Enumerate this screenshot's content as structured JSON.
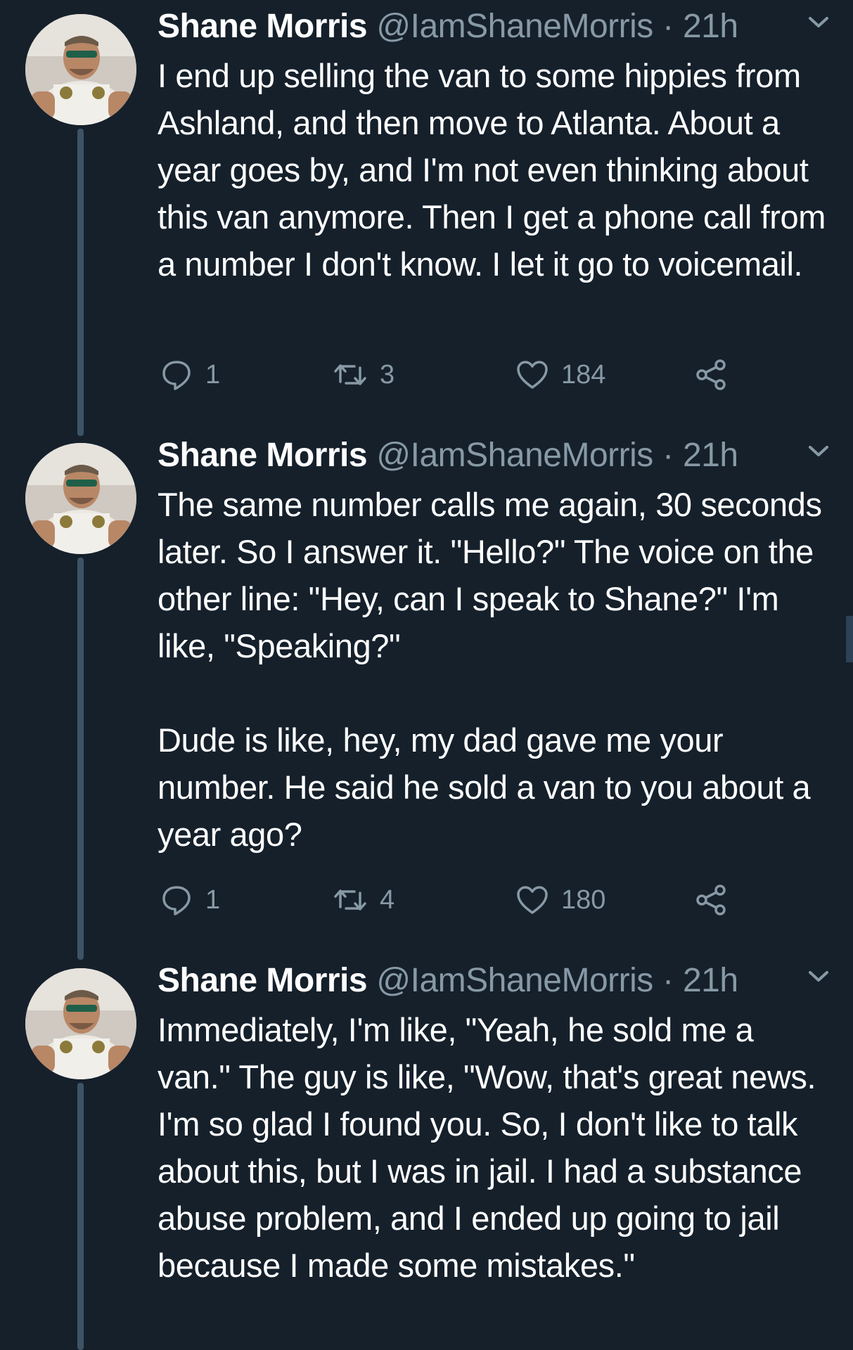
{
  "colors": {
    "background": "#15202b",
    "text_primary": "#ffffff",
    "text_secondary": "#8899a6",
    "thread_line": "#3d5466"
  },
  "tweets": [
    {
      "name": "Shane Morris",
      "handle": "@IamShaneMorris",
      "separator": "·",
      "time": "21h",
      "paragraphs": [
        "I end up selling the van to some hippies from Ashland, and then move to Atlanta. About a year goes by, and I'm not even thinking about this van anymore. Then I get a phone call from a number I don't know. I let it go to voicemail."
      ],
      "replies": "1",
      "retweets": "3",
      "likes": "184",
      "icons": [
        "reply-icon",
        "retweet-icon",
        "like-icon",
        "share-icon",
        "chevron-down-icon"
      ]
    },
    {
      "name": "Shane Morris",
      "handle": "@IamShaneMorris",
      "separator": "·",
      "time": "21h",
      "paragraphs": [
        "The same number calls me again, 30 seconds later. So I answer it. \"Hello?\" The voice on the other line: \"Hey, can I speak to Shane?\" I'm like, \"Speaking?\"",
        "Dude is like, hey, my dad gave me your number. He said he sold a van to you about a year ago?"
      ],
      "replies": "1",
      "retweets": "4",
      "likes": "180",
      "icons": [
        "reply-icon",
        "retweet-icon",
        "like-icon",
        "share-icon",
        "chevron-down-icon"
      ]
    },
    {
      "name": "Shane Morris",
      "handle": "@IamShaneMorris",
      "separator": "·",
      "time": "21h",
      "paragraphs": [
        "Immediately, I'm like, \"Yeah, he sold me a van.\" The guy is like, \"Wow, that's great news. I'm so glad I found you. So, I don't like to talk about this, but I was in jail. I had a substance abuse problem, and I ended up going to jail because I made some mistakes.\""
      ],
      "icons": [
        "chevron-down-icon"
      ]
    }
  ]
}
